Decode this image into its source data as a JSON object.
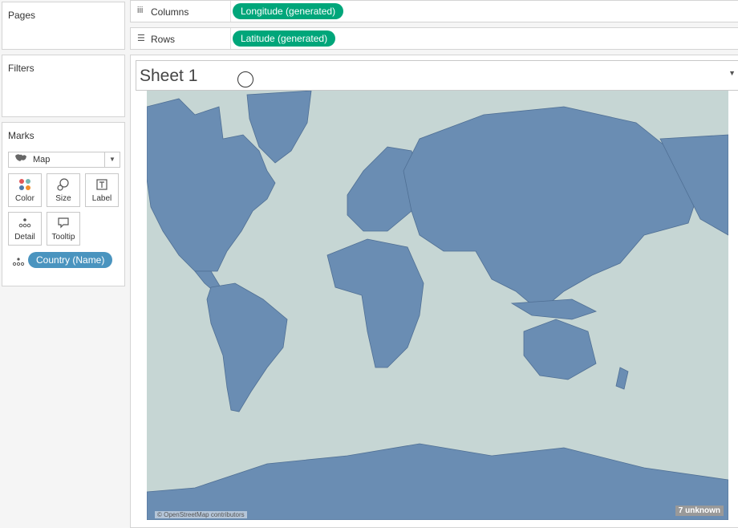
{
  "pages": {
    "title": "Pages"
  },
  "filters": {
    "title": "Filters"
  },
  "marks": {
    "title": "Marks",
    "type_icon": "map-icon",
    "type_label": "Map",
    "buttons": [
      {
        "label": "Color",
        "icon": "color-icon"
      },
      {
        "label": "Size",
        "icon": "size-icon"
      },
      {
        "label": "Label",
        "icon": "label-icon"
      },
      {
        "label": "Detail",
        "icon": "detail-icon"
      },
      {
        "label": "Tooltip",
        "icon": "tooltip-icon"
      }
    ],
    "detail_pill": "Country (Name)"
  },
  "shelves": {
    "columns": {
      "label": "Columns",
      "pill": "Longitude (generated)"
    },
    "rows": {
      "label": "Rows",
      "pill": "Latitude (generated)"
    }
  },
  "view": {
    "title": "Sheet 1",
    "attribution": "© OpenStreetMap contributors",
    "unknown_badge": "7 unknown"
  },
  "colors": {
    "pill_green": "#00a67a",
    "pill_blue": "#4a94bf",
    "ocean": "#c6d6d4",
    "land": "#6a8db3"
  }
}
